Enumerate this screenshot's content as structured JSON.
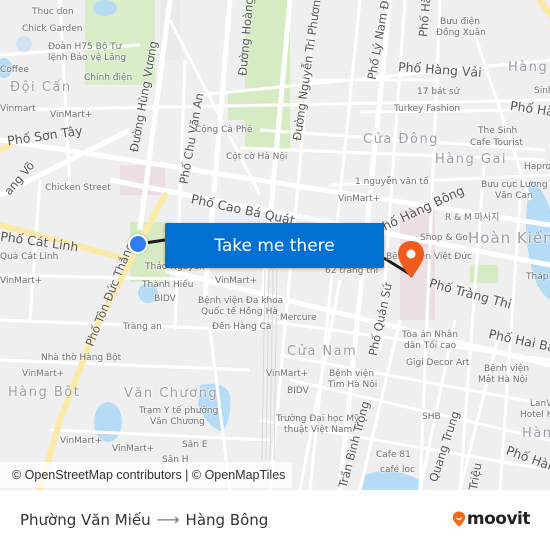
{
  "map": {
    "colors": {
      "background": "#efefef",
      "road": "#ffffff",
      "major_road": "#fbe9a6",
      "park": "#d5ecc3",
      "water": "#b6dcf5",
      "route_line": "#1a1a1a",
      "origin_marker": "#2d7ff0",
      "destination_marker": "#f05a1e",
      "cta_background": "#0070d1",
      "hospital_area": "#ecdfe4"
    },
    "districts": [
      "Đội Cấn",
      "Cửa Đông",
      "Hàng Gai",
      "Hoàn Kiếm",
      "Cửa Nam",
      "Văn Chương",
      "Hàng Bột",
      "Hàng",
      "Hàng"
    ],
    "streets": [
      "Phố Sơn Tây",
      "Đường Hùng Vương",
      "Phố Chu Văn An",
      "Đường Hoàng",
      "Đường Nguyễn Tri Phương",
      "Phố Lý Nam Đế",
      "Phố Hà",
      "Phố Hàng Vải",
      "Phố Hà",
      "Phố Cao Bá Quát",
      "Phố Hàng Bông",
      "Phố Cát Linh",
      "Phố Tôn Đức Thắng",
      "Phố Tràng Thi",
      "Phố Quán Sứ",
      "Phố Hai Bà",
      "Phố Hàn",
      "Đường Giảng Võ",
      "Trần Bình Trọng",
      "Quang Trung",
      "Triệu"
    ],
    "pois": [
      "Thuc don",
      "Chick Garden",
      "Đoàn H75 Bộ Tư lệnh Bảo vệ Lăng",
      "Coffee",
      "Chính điện",
      "Vinmart",
      "VinMart+",
      "Cộng Cà Phê",
      "Cột cờ Hà Nội",
      "Chicken Street",
      "Bưu điện Đồng Xuân",
      "17 bát sứ",
      "Turkey Fashion",
      "The Sinh Cafe Tourist",
      "Hapro",
      "Sinh",
      "1 nguyễn văn tố",
      "Bưu cục Lương Văn Can",
      "R & M 마사지",
      "Shop & Go",
      "Bệnh viện Việt Đức",
      "62 tràng thi",
      "Tháp",
      "Quà Cát Linh",
      "Thảo Nguyên",
      "Thành Hiếu",
      "BIDV",
      "Bệnh viện Đa khoa Quốc tế Hồng Hà",
      "Đền Hàng Cà",
      "Tràng an",
      "Mercure",
      "Tòa án Nhân dân Tối cao",
      "Gigi Decor Art",
      "Bệnh viện Mắt Hà Nội",
      "Bệnh viện Tim Hà Nội",
      "LanVi Hotel",
      "Nhà thờ Hàng Bột",
      "Trạm Y tế phường Văn Chương",
      "Sân E",
      "Sân H",
      "Trường Đại học Mỹ thuật Việt Nam",
      "SHB",
      "Cafe 81",
      "café loc",
      "Bệnh viện đa"
    ],
    "cta_label": "Take me there",
    "attribution": "© OpenStreetMap contributors | © OpenMapTiles"
  },
  "labels": {
    "thucdon": "Thuc don",
    "chick": "Chick Garden",
    "h75a": "Đoàn H75 Bộ Tư",
    "h75b": "lệnh Bảo vệ Lăng",
    "coffee": "Coffee",
    "chinhdien": "Chính điện",
    "doican": "Đội Cấn",
    "vinmart": "Vinmart",
    "vinmartplus": "VinMart+",
    "sontay": "Phố Sơn Tây",
    "hungvuong": "Đường Hùng Vương",
    "chuvanan": "Phố Chu Văn An",
    "hoang": "Đường Hoàng",
    "nguyentriphuong": "Đường Nguyễn Tri Phương",
    "congcaphe": "Cộng Cà Phê",
    "cotco": "Cột cờ Hà Nội",
    "giangvo": "ang Võ",
    "chickenstreet": "Chicken Street",
    "lynamde": "Phố Lý Nam Đế",
    "phoha": "Phố Hà",
    "buudien1": "Bưu điện",
    "buudien2": "Đồng Xuân",
    "hangvai": "Phố Hàng Vải",
    "hang1": "Hàng",
    "batsu": "17 bát sứ",
    "turkey": "Turkey Fashion",
    "phoha2": "Phố Hà",
    "sinh": "Sinh",
    "thesinh1": "The Sinh",
    "thesinh2": "Cafe Tourist",
    "cuadong": "Cửa Đông",
    "hanggai": "Hàng Gai",
    "hapro": "Hapro",
    "nguyenvanto": "1 nguyễn văn tố",
    "buucuc1": "Bưu cục Lương",
    "buucuc2": "Văn Can",
    "caobaquat": "Phố Cao Bá Quát",
    "hangbong": "Phố Hàng Bông",
    "rm": "R & M 마사지",
    "shopgo": "Shop & Go",
    "hoankiem": "Hoàn Kiếm",
    "benhvien": "Bệnh viện Việt Đức",
    "catlinh": "Phố Cát Linh",
    "quacatlinh": "Quà Cát Linh",
    "trangthi62": "62 tràng thi",
    "thap": "Tháp",
    "trangthi": "Phố Tràng Thi",
    "quansu": "Phố Quán Sứ",
    "tonducthang": "Phố Tôn Đức Thắng",
    "thaonguyen": "Thảo Nguyên",
    "thanhhieu": "Thành Hiếu",
    "bidv": "BIDV",
    "hongha1": "Bệnh viện Đa khoa",
    "hongha2": "Quốc tế Hồng Hà",
    "denhangca": "Đền Hàng Cà",
    "trangan": "Tràng an",
    "mercure": "Mercure",
    "toaan1": "Tòa án Nhân",
    "toaan2": "dân Tối cao",
    "haiba": "Phố Hai Bà",
    "cuanam": "Cửa Nam",
    "gigi": "Gigi Decor Art",
    "mat1": "Bệnh viện",
    "mat2": "Mắt Hà Nội",
    "nhatho": "Nhà thờ Hàng Bột",
    "tim1": "Bệnh viện",
    "tim2": "Tim Hà Nội",
    "hangbot": "Hàng Bột",
    "vanchuong": "Văn Chương",
    "tram1": "Trạm Y tế phường",
    "tram2": "Văn Chương",
    "lanvi1": "LanVi",
    "lanvi2": "Hotel H",
    "hang2": "Hàn",
    "mythuat1": "Trường Đại học Mỹ",
    "mythuat2": "thuật Việt Nam",
    "shb": "SHB",
    "sane": "Sân E",
    "sanh": "Sân H",
    "binhtrong": "Trần Bình Trọng",
    "quangtrung": "Quang Trung",
    "trieu": "Triệu",
    "cafe81": "Cafe 81",
    "cafeloc": "café loc",
    "phohan": "Phố Hàn",
    "benhviendа": "Bệnh viện đa"
  },
  "footer": {
    "origin": "Phường Văn Miếu",
    "arrow": "⟶",
    "destination": "Hàng Bông",
    "brand": "moovit",
    "brand_color": "#f06a19"
  }
}
